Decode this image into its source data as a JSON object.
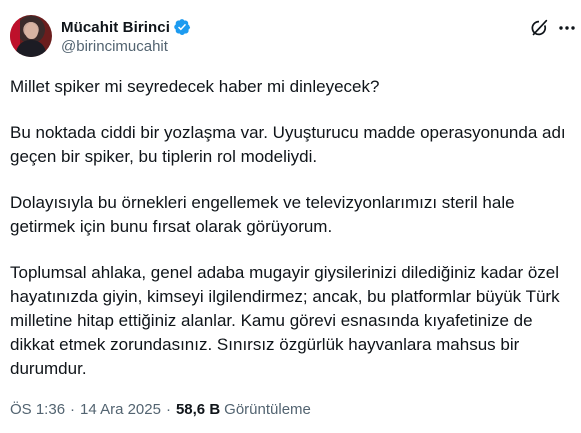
{
  "tweet": {
    "author": {
      "display_name": "Mücahit Birinci",
      "handle": "@birincimucahit",
      "verified": true,
      "verified_color": "#1d9bf0"
    },
    "icons": {
      "grok": "grok-icon",
      "more": "more-options-icon"
    },
    "paragraphs": [
      "Millet spiker mi seyredecek haber mi dinleyecek?",
      "Bu noktada ciddi bir yozlaşma var. Uyuşturucu madde operasyonunda adı geçen bir spiker, bu tiplerin rol modeliydi.",
      "Dolayısıyla bu örnekleri engellemek ve televizyonlarımızı steril hale getirmek için bunu fırsat olarak görüyorum.",
      "Toplumsal ahlaka, genel adaba mugayir giysilerinizi dilediğiniz kadar özel hayatınızda giyin, kimseyi ilgilendirmez; ancak, bu platformlar büyük Türk milletine hitap ettiğiniz alanlar. Kamu görevi esnasında kıyafetinize de dikkat etmek zorundasınız. Sınırsız özgürlük hayvanlara mahsus bir durumdur."
    ],
    "meta": {
      "time": "ÖS 1:36",
      "date": "14 Ara 2025",
      "separator": "·",
      "views_count": "58,6 B",
      "views_label": "Görüntüleme"
    }
  }
}
